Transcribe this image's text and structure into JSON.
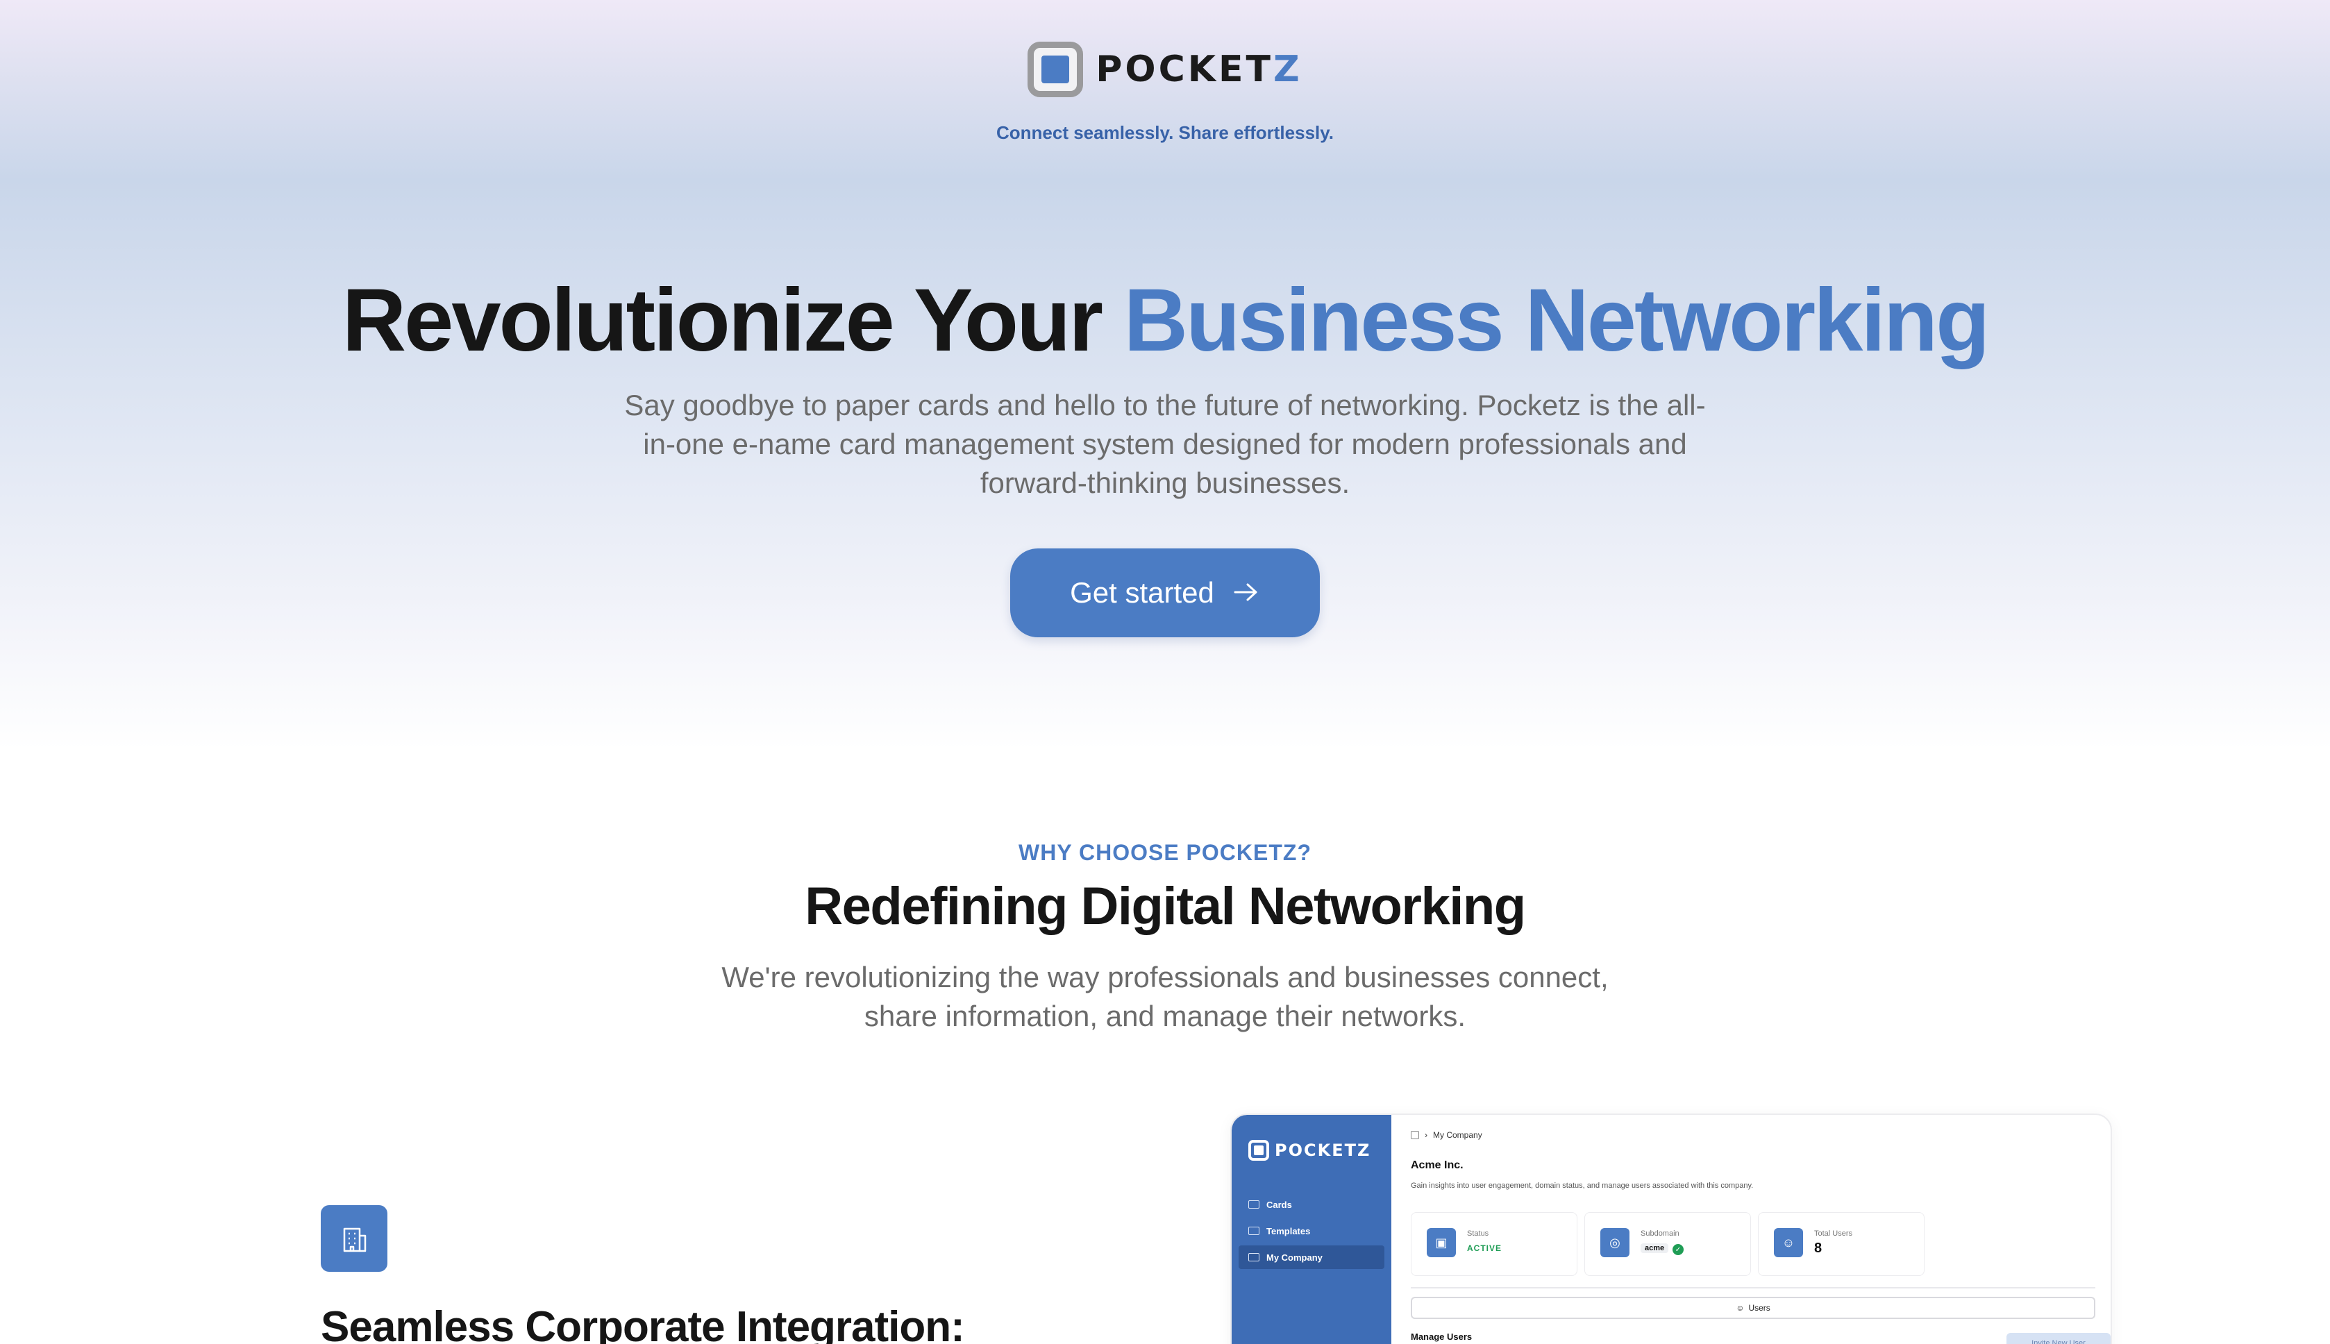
{
  "brand": {
    "name_main": "POCKET",
    "name_accent": "Z",
    "tagline": "Connect seamlessly. Share effortlessly.",
    "accent_color": "#4b7cc4"
  },
  "hero": {
    "headline_main": "Revolutionize Your ",
    "headline_accent": "Business Networking",
    "subtitle": "Say goodbye to paper cards and hello to the future of networking. Pocketz is the all-in-one e-name card management system designed for modern professionals and forward-thinking businesses.",
    "cta_label": "Get started",
    "cta_icon": "arrow-right-icon"
  },
  "why": {
    "eyebrow": "WHY CHOOSE POCKETZ?",
    "title": "Redefining Digital Networking",
    "subtitle": "We're revolutionizing the way professionals and businesses connect, share information, and manage their networks."
  },
  "feature": {
    "icon": "building-icon",
    "title": "Seamless Corporate Integration:"
  },
  "dashboard": {
    "logo": "POCKETZ",
    "nav": [
      "Cards",
      "Templates",
      "My Company"
    ],
    "active_nav": "My Company",
    "breadcrumb": "My Company",
    "company_name": "Acme Inc.",
    "description": "Gain insights into user engagement, domain status, and manage users associated with this company.",
    "status_label": "Status",
    "status_value": "ACTIVE",
    "subdomain_label": "Subdomain",
    "subdomain_value": "acme",
    "users_label": "Total Users",
    "users_value": "8",
    "tab_label": "Users",
    "manage_label": "Manage Users",
    "invite_label": "Invite New User"
  }
}
